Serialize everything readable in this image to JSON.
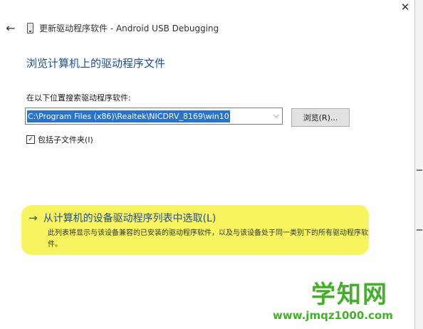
{
  "window": {
    "close_glyph": "✕",
    "back_glyph": "←",
    "device_icon": "usb-device-icon",
    "title": "更新驱动程序软件 - Android USB Debugging"
  },
  "main": {
    "heading": "浏览计算机上的驱动程序文件",
    "search_label": "在以下位置搜索驱动程序软件:",
    "path_value": "C:\\Program Files (x86)\\Realtek\\NICDRV_8169\\win10",
    "combo_arrow": "⌵",
    "browse_label": "浏览(R)...",
    "include_subfolders_label": "包括子文件夹(I)",
    "include_subfolders_checked": true,
    "check_glyph": "✓"
  },
  "pick": {
    "arrow": "→",
    "title": "从计算机的设备驱动程序列表中选取(L)",
    "description": "此列表将显示与该设备兼容的已安装的驱动程序软件，以及与该设备处于同一类别下的所有驱动程序软件。"
  },
  "watermark": {
    "logo_text": "学知网",
    "url": "www.jmqz1000.com"
  },
  "colors": {
    "heading_blue": "#1f4e96",
    "selection_blue": "#2a73cc",
    "highlight_yellow": "#f7f24a",
    "watermark_green": "#43b02a"
  }
}
